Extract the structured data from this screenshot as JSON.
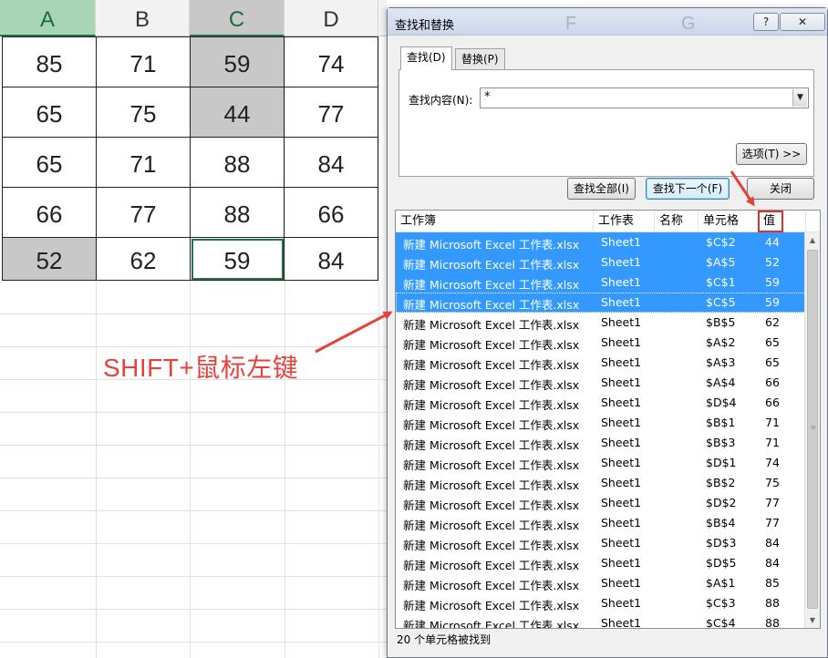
{
  "sheet": {
    "columns": [
      "A",
      "B",
      "C",
      "D"
    ],
    "rows": [
      [
        "85",
        "71",
        "59",
        "74"
      ],
      [
        "65",
        "75",
        "44",
        "77"
      ],
      [
        "65",
        "71",
        "88",
        "84"
      ],
      [
        "66",
        "77",
        "88",
        "66"
      ],
      [
        "52",
        "62",
        "59",
        "84"
      ]
    ],
    "highlighted_cells": [
      "C1",
      "C2",
      "A5"
    ],
    "active_cell": "C5",
    "highlight_color": "#c8c8c8"
  },
  "annotation": {
    "text": "SHIFT+鼠标左键",
    "color": "#e8413b"
  },
  "dialog": {
    "title": "查找和替换",
    "title_ghost_letters": [
      "F",
      "G"
    ],
    "help_button": "?",
    "close_button": "✕",
    "tabs": [
      {
        "label": "查找(D)",
        "active": true
      },
      {
        "label": "替换(P)",
        "active": false
      }
    ],
    "find_label": "查找内容(N):",
    "find_value": "*",
    "options_button": "选项(T) >>",
    "find_all_button": "查找全部(I)",
    "find_next_button": "查找下一个(F)",
    "close_label": "关闭",
    "columns": [
      "工作簿",
      "工作表",
      "名称",
      "单元格",
      "值"
    ],
    "results": [
      {
        "workbook": "新建 Microsoft Excel 工作表.xlsx",
        "sheet": "Sheet1",
        "cell": "$C$2",
        "value": "44",
        "selected": true
      },
      {
        "workbook": "新建 Microsoft Excel 工作表.xlsx",
        "sheet": "Sheet1",
        "cell": "$A$5",
        "value": "52",
        "selected": true
      },
      {
        "workbook": "新建 Microsoft Excel 工作表.xlsx",
        "sheet": "Sheet1",
        "cell": "$C$1",
        "value": "59",
        "selected": true
      },
      {
        "workbook": "新建 Microsoft Excel 工作表.xlsx",
        "sheet": "Sheet1",
        "cell": "$C$5",
        "value": "59",
        "selected": true
      },
      {
        "workbook": "新建 Microsoft Excel 工作表.xlsx",
        "sheet": "Sheet1",
        "cell": "$B$5",
        "value": "62",
        "selected": false
      },
      {
        "workbook": "新建 Microsoft Excel 工作表.xlsx",
        "sheet": "Sheet1",
        "cell": "$A$2",
        "value": "65",
        "selected": false
      },
      {
        "workbook": "新建 Microsoft Excel 工作表.xlsx",
        "sheet": "Sheet1",
        "cell": "$A$3",
        "value": "65",
        "selected": false
      },
      {
        "workbook": "新建 Microsoft Excel 工作表.xlsx",
        "sheet": "Sheet1",
        "cell": "$A$4",
        "value": "66",
        "selected": false
      },
      {
        "workbook": "新建 Microsoft Excel 工作表.xlsx",
        "sheet": "Sheet1",
        "cell": "$D$4",
        "value": "66",
        "selected": false
      },
      {
        "workbook": "新建 Microsoft Excel 工作表.xlsx",
        "sheet": "Sheet1",
        "cell": "$B$1",
        "value": "71",
        "selected": false
      },
      {
        "workbook": "新建 Microsoft Excel 工作表.xlsx",
        "sheet": "Sheet1",
        "cell": "$B$3",
        "value": "71",
        "selected": false
      },
      {
        "workbook": "新建 Microsoft Excel 工作表.xlsx",
        "sheet": "Sheet1",
        "cell": "$D$1",
        "value": "74",
        "selected": false
      },
      {
        "workbook": "新建 Microsoft Excel 工作表.xlsx",
        "sheet": "Sheet1",
        "cell": "$B$2",
        "value": "75",
        "selected": false
      },
      {
        "workbook": "新建 Microsoft Excel 工作表.xlsx",
        "sheet": "Sheet1",
        "cell": "$D$2",
        "value": "77",
        "selected": false
      },
      {
        "workbook": "新建 Microsoft Excel 工作表.xlsx",
        "sheet": "Sheet1",
        "cell": "$B$4",
        "value": "77",
        "selected": false
      },
      {
        "workbook": "新建 Microsoft Excel 工作表.xlsx",
        "sheet": "Sheet1",
        "cell": "$D$3",
        "value": "84",
        "selected": false
      },
      {
        "workbook": "新建 Microsoft Excel 工作表.xlsx",
        "sheet": "Sheet1",
        "cell": "$D$5",
        "value": "84",
        "selected": false
      },
      {
        "workbook": "新建 Microsoft Excel 工作表.xlsx",
        "sheet": "Sheet1",
        "cell": "$A$1",
        "value": "85",
        "selected": false
      },
      {
        "workbook": "新建 Microsoft Excel 工作表.xlsx",
        "sheet": "Sheet1",
        "cell": "$C$3",
        "value": "88",
        "selected": false
      },
      {
        "workbook": "新建 Microsoft Excel 工作表.xlsx",
        "sheet": "Sheet1",
        "cell": "$C$4",
        "value": "88",
        "selected": false
      }
    ],
    "status": "20 个单元格被找到",
    "selection_color": "#3399ff",
    "highlight_box_color": "#e0302c"
  }
}
